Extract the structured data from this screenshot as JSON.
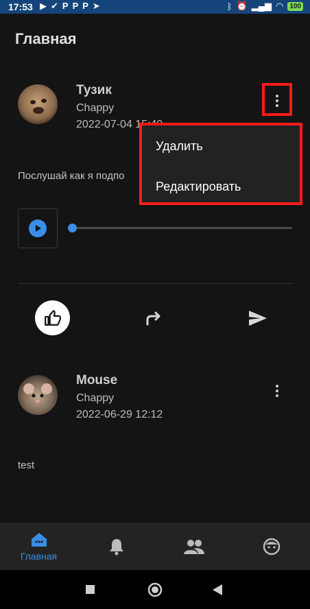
{
  "status_bar": {
    "time": "17:53",
    "battery": "100"
  },
  "page": {
    "title": "Главная"
  },
  "posts": [
    {
      "author": "Тузик",
      "app": "Chappy",
      "date": "2022-07-04 15:49",
      "text": "Послушай как я подпо",
      "has_audio": true,
      "audio_progress": 0.0
    },
    {
      "author": "Mouse",
      "app": "Chappy",
      "date": "2022-06-29 12:12",
      "text": "test"
    }
  ],
  "context_menu": {
    "items": [
      "Удалить",
      "Редактировать"
    ]
  },
  "bottom_nav": {
    "items": [
      {
        "label": "Главная",
        "icon": "home-icon",
        "active": true
      },
      {
        "label": "",
        "icon": "bell-icon",
        "active": false
      },
      {
        "label": "",
        "icon": "people-icon",
        "active": false
      },
      {
        "label": "",
        "icon": "face-icon",
        "active": false
      }
    ]
  },
  "colors": {
    "accent": "#3a8ee6",
    "highlight": "#ff1a1a",
    "status_bar": "#15447a",
    "background": "#141414"
  }
}
